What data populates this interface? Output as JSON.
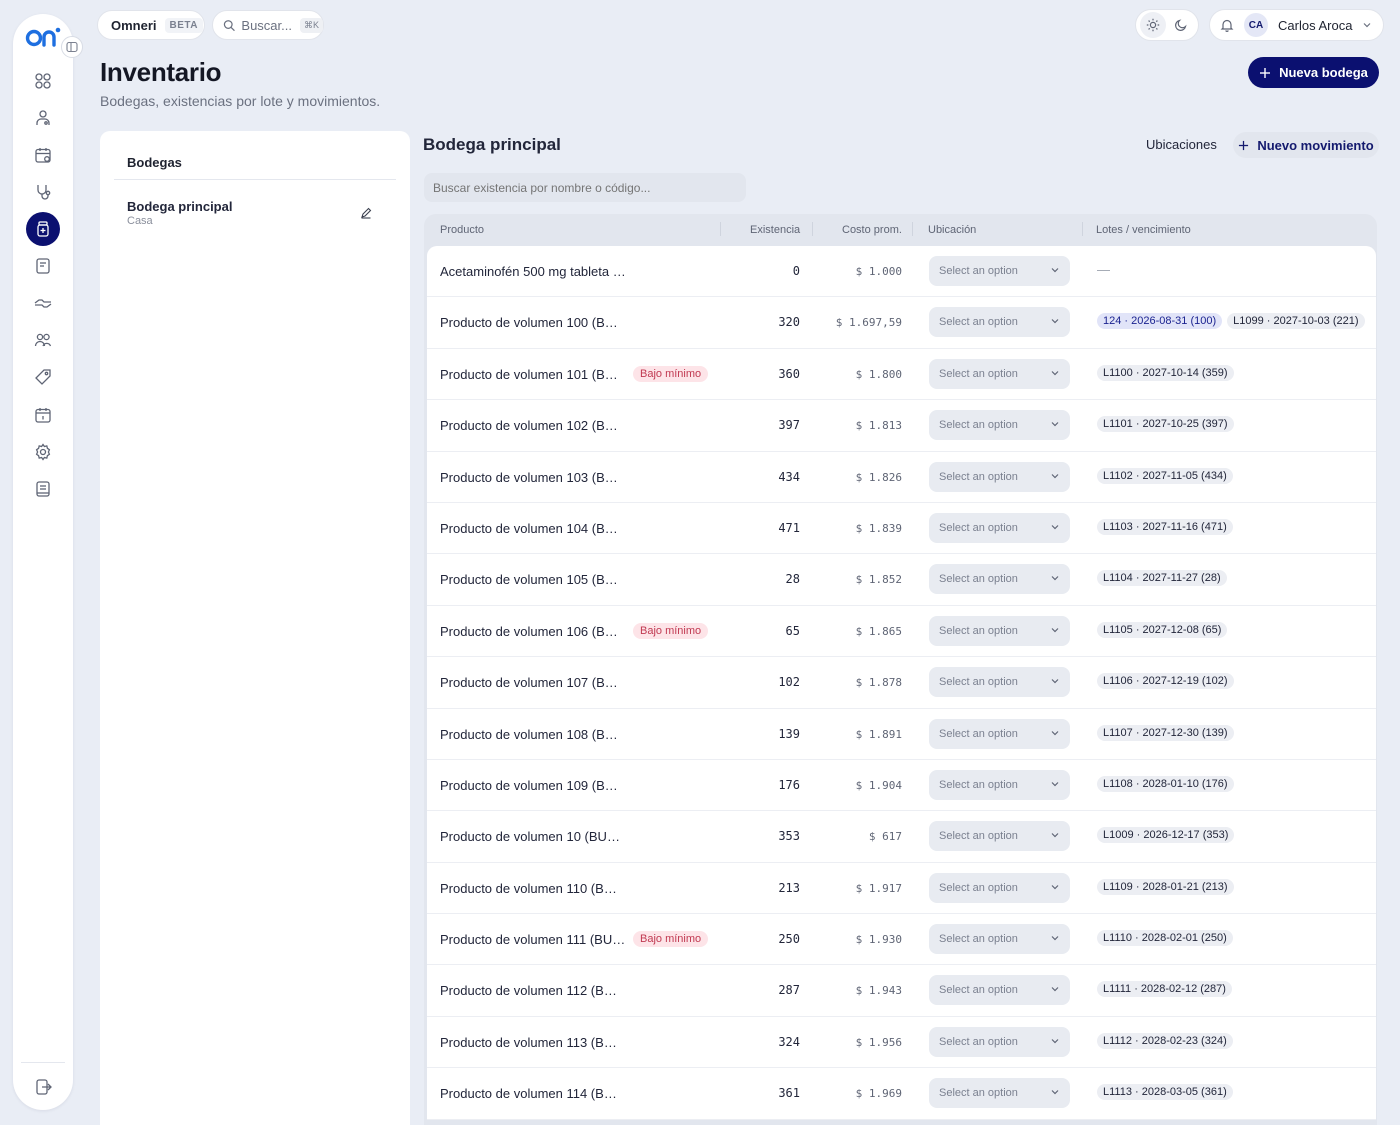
{
  "topbar": {
    "brand": "Omneri",
    "beta": "BETA",
    "search_placeholder": "Buscar...",
    "search_shortcut": "⌘K",
    "user_initials": "CA",
    "user_name": "Carlos Aroca"
  },
  "page": {
    "title": "Inventario",
    "subtitle": "Bodegas, existencias por lote y movimientos.",
    "new_warehouse_label": "Nueva bodega"
  },
  "warehouses": {
    "heading": "Bodegas",
    "items": [
      {
        "name": "Bodega principal",
        "location": "Casa"
      }
    ]
  },
  "main": {
    "title": "Bodega principal",
    "locations_label": "Ubicaciones",
    "new_movement_label": "Nuevo movimiento",
    "search_placeholder": "Buscar existencia por nombre o código..."
  },
  "table": {
    "columns": [
      "Producto",
      "Existencia",
      "Costo prom.",
      "Ubicación",
      "Lotes / vencimiento"
    ],
    "select_placeholder": "Select an option",
    "empty_lots": "—",
    "low_stock_label": "Bajo mínimo",
    "rows": [
      {
        "name": "Acetaminofén 500 mg tableta (...",
        "low": false,
        "qty": "0",
        "cost": "$ 1.000",
        "lots": []
      },
      {
        "name": "Producto de volumen 100 (BUL...",
        "low": false,
        "qty": "320",
        "cost": "$ 1.697,59",
        "lots": [
          {
            "label": "124 · 2026-08-31 (100)",
            "highlight": true
          },
          {
            "label": "L1099 · 2027-10-03 (221)",
            "highlight": false
          }
        ]
      },
      {
        "name": "Producto de volumen 101 (BUL...",
        "low": true,
        "qty": "360",
        "cost": "$ 1.800",
        "lots": [
          {
            "label": "L1100 · 2027-10-14 (359)",
            "highlight": false
          }
        ]
      },
      {
        "name": "Producto de volumen 102 (BUL...",
        "low": false,
        "qty": "397",
        "cost": "$ 1.813",
        "lots": [
          {
            "label": "L1101 · 2027-10-25 (397)",
            "highlight": false
          }
        ]
      },
      {
        "name": "Producto de volumen 103 (BUL...",
        "low": false,
        "qty": "434",
        "cost": "$ 1.826",
        "lots": [
          {
            "label": "L1102 · 2027-11-05 (434)",
            "highlight": false
          }
        ]
      },
      {
        "name": "Producto de volumen 104 (BUL...",
        "low": false,
        "qty": "471",
        "cost": "$ 1.839",
        "lots": [
          {
            "label": "L1103 · 2027-11-16 (471)",
            "highlight": false
          }
        ]
      },
      {
        "name": "Producto de volumen 105 (BUL...",
        "low": false,
        "qty": "28",
        "cost": "$ 1.852",
        "lots": [
          {
            "label": "L1104 · 2027-11-27 (28)",
            "highlight": false
          }
        ]
      },
      {
        "name": "Producto de volumen 106 (BUL...",
        "low": true,
        "qty": "65",
        "cost": "$ 1.865",
        "lots": [
          {
            "label": "L1105 · 2027-12-08 (65)",
            "highlight": false
          }
        ]
      },
      {
        "name": "Producto de volumen 107 (BUL...",
        "low": false,
        "qty": "102",
        "cost": "$ 1.878",
        "lots": [
          {
            "label": "L1106 · 2027-12-19 (102)",
            "highlight": false
          }
        ]
      },
      {
        "name": "Producto de volumen 108 (BUL...",
        "low": false,
        "qty": "139",
        "cost": "$ 1.891",
        "lots": [
          {
            "label": "L1107 · 2027-12-30 (139)",
            "highlight": false
          }
        ]
      },
      {
        "name": "Producto de volumen 109 (BUL...",
        "low": false,
        "qty": "176",
        "cost": "$ 1.904",
        "lots": [
          {
            "label": "L1108 · 2028-01-10 (176)",
            "highlight": false
          }
        ]
      },
      {
        "name": "Producto de volumen 10 (BULK...",
        "low": false,
        "qty": "353",
        "cost": "$ 617",
        "lots": [
          {
            "label": "L1009 · 2026-12-17 (353)",
            "highlight": false
          }
        ]
      },
      {
        "name": "Producto de volumen 110 (BUL...",
        "low": false,
        "qty": "213",
        "cost": "$ 1.917",
        "lots": [
          {
            "label": "L1109 · 2028-01-21 (213)",
            "highlight": false
          }
        ]
      },
      {
        "name": "Producto de volumen 111 (BUL...",
        "low": true,
        "qty": "250",
        "cost": "$ 1.930",
        "lots": [
          {
            "label": "L1110 · 2028-02-01 (250)",
            "highlight": false
          }
        ]
      },
      {
        "name": "Producto de volumen 112 (BUL...",
        "low": false,
        "qty": "287",
        "cost": "$ 1.943",
        "lots": [
          {
            "label": "L1111 · 2028-02-12 (287)",
            "highlight": false
          }
        ]
      },
      {
        "name": "Producto de volumen 113 (BUL...",
        "low": false,
        "qty": "324",
        "cost": "$ 1.956",
        "lots": [
          {
            "label": "L1112 · 2028-02-23 (324)",
            "highlight": false
          }
        ]
      },
      {
        "name": "Producto de volumen 114 (BUL...",
        "low": false,
        "qty": "361",
        "cost": "$ 1.969",
        "lots": [
          {
            "label": "L1113 · 2028-03-05 (361)",
            "highlight": false
          }
        ]
      }
    ]
  },
  "sidebar": {
    "items": [
      {
        "icon": "dashboard-icon",
        "active": false
      },
      {
        "icon": "patients-icon",
        "active": false
      },
      {
        "icon": "calendar-check-icon",
        "active": false
      },
      {
        "icon": "stethoscope-icon",
        "active": false
      },
      {
        "icon": "medicine-bottle-icon",
        "active": true
      },
      {
        "icon": "notebook-icon",
        "active": false
      },
      {
        "icon": "handshake-icon",
        "active": false
      },
      {
        "icon": "users-icon",
        "active": false
      },
      {
        "icon": "tag-icon",
        "active": false
      },
      {
        "icon": "calendar-icon",
        "active": false
      },
      {
        "icon": "settings-icon",
        "active": false
      },
      {
        "icon": "book-icon",
        "active": false
      }
    ],
    "logout_icon": "logout-icon"
  },
  "colors": {
    "primary": "#0b1070",
    "background": "#e9edf5",
    "low_stock_text": "#c13a52",
    "low_stock_bg": "#fde4e8"
  }
}
